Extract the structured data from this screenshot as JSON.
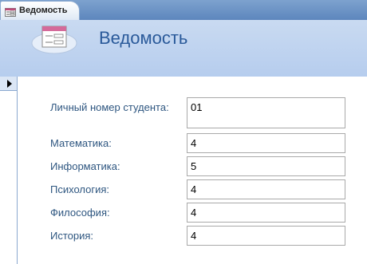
{
  "tab": {
    "label": "Ведомость",
    "icon": "form-icon"
  },
  "header": {
    "title": "Ведомость",
    "logo_icon": "form-logo-icon"
  },
  "record_selector": {
    "icon": "current-record-arrow-icon"
  },
  "fields": [
    {
      "label": "Личный номер студента:",
      "value": "01"
    },
    {
      "label": "Математика:",
      "value": "4"
    },
    {
      "label": "Информатика:",
      "value": "5"
    },
    {
      "label": "Психология:",
      "value": "4"
    },
    {
      "label": "Философия:",
      "value": "4"
    },
    {
      "label": "История:",
      "value": "4"
    }
  ],
  "colors": {
    "tabstrip": "#5d86bd",
    "header": "#c0d4f0",
    "title": "#2a5a9a",
    "label": "#2e5680"
  }
}
